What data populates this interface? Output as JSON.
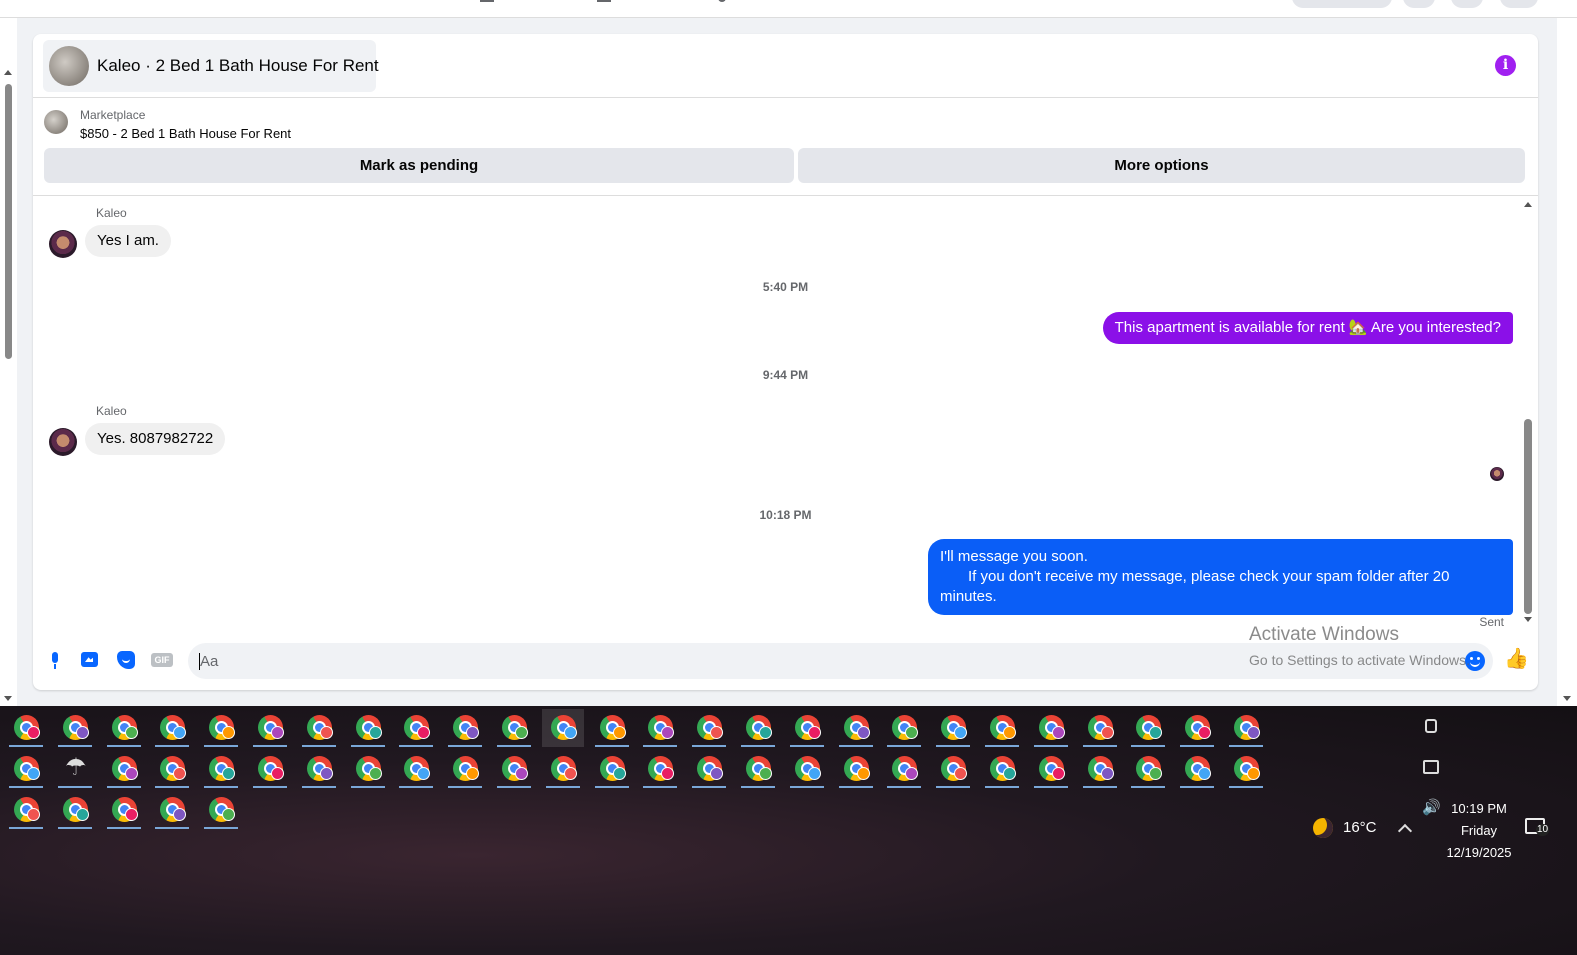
{
  "chat": {
    "title": "Kaleo · 2 Bed 1 Bath House For Rent",
    "listing": {
      "source": "Marketplace",
      "price_title": "$850 - 2 Bed 1 Bath House For Rent",
      "pending_button": "Mark as pending",
      "more_button": "More options"
    },
    "messages": {
      "m1_sender": "Kaleo",
      "m1_text": "Yes I am.",
      "ts1": "5:40 PM",
      "m2_text": "This apartment is available for rent 🏡 Are you interested?",
      "ts2": "9:44 PM",
      "m3_sender": "Kaleo",
      "m3_text": "Yes. 8087982722",
      "ts3": "10:18 PM",
      "m4_line1": "I'll message you soon.",
      "m4_line2": "If you don't receive my message, please check your spam folder after 20",
      "m4_line3": "minutes.",
      "status": "Sent"
    },
    "composer": {
      "placeholder": "Aa",
      "gif_label": "GIF"
    },
    "colors": {
      "outgoing_purple": "#8b10e8",
      "outgoing_blue": "#0a5ef7",
      "accent": "#0866ff",
      "info": "#a020f0"
    }
  },
  "watermark": {
    "line1": "Activate Windows",
    "line2": "Go to Settings to activate Windows."
  },
  "taskbar": {
    "apps_row1": [
      "chrome",
      "chrome",
      "chrome",
      "chrome",
      "chrome",
      "chrome",
      "chrome",
      "chrome",
      "chrome",
      "chrome",
      "chrome",
      "chrome",
      "chrome",
      "chrome",
      "chrome",
      "chrome",
      "chrome",
      "chrome",
      "chrome",
      "chrome",
      "chrome",
      "chrome",
      "chrome",
      "chrome",
      "chrome",
      "chrome"
    ],
    "apps_row2": [
      "chrome",
      "umbrella",
      "chrome",
      "chrome",
      "chrome",
      "chrome",
      "chrome",
      "chrome",
      "chrome",
      "chrome",
      "chrome",
      "chrome",
      "chrome",
      "chrome",
      "chrome",
      "chrome",
      "chrome",
      "chrome",
      "chrome",
      "chrome",
      "chrome",
      "chrome",
      "chrome",
      "chrome",
      "chrome",
      "chrome"
    ],
    "apps_row3": [
      "chrome",
      "chrome",
      "chrome",
      "chrome",
      "chrome"
    ],
    "weather": "16°C",
    "time": "10:19 PM",
    "day": "Friday",
    "date": "12/19/2025",
    "notifications": "10"
  }
}
